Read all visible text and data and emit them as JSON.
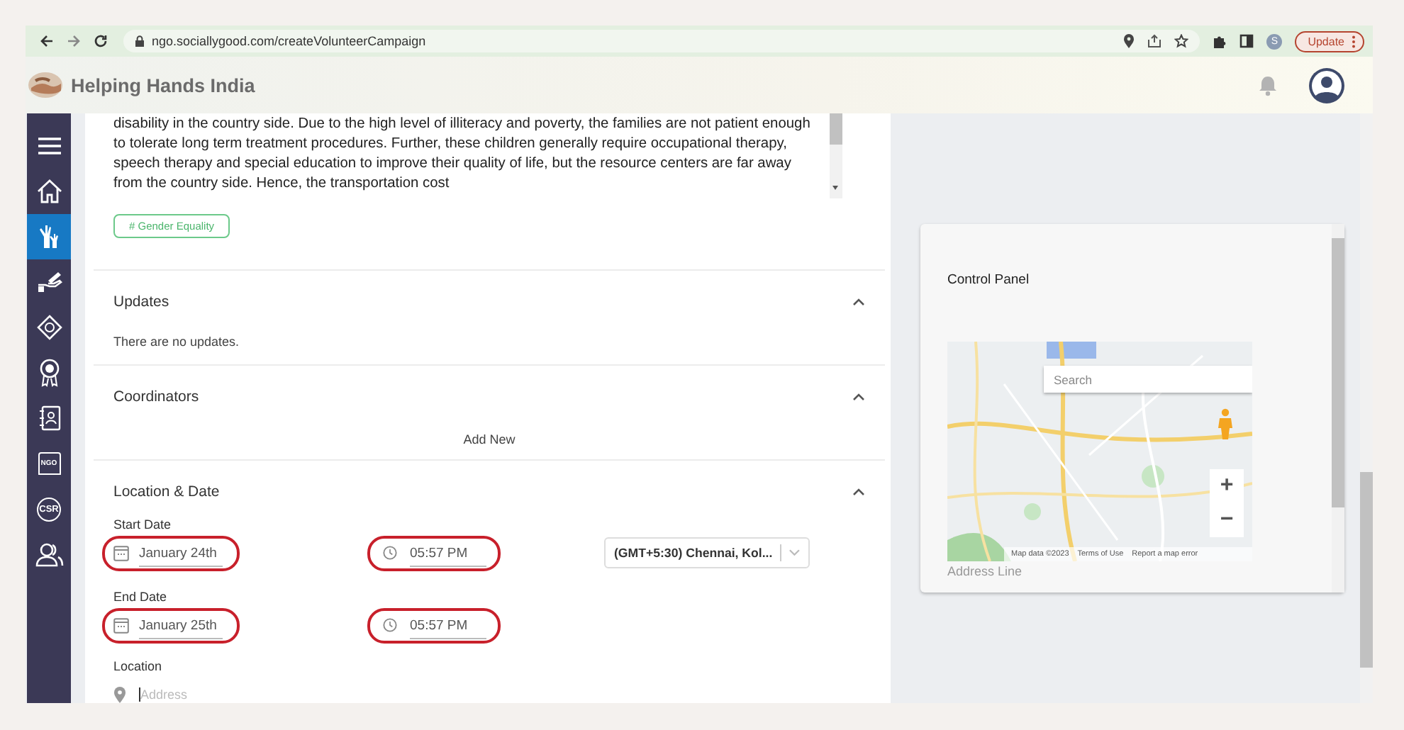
{
  "browser": {
    "url": "ngo.sociallygood.com/createVolunteerCampaign",
    "profile_initial": "S",
    "update_button": "Update"
  },
  "app": {
    "title": "Helping Hands India"
  },
  "sidebar": {
    "items": [
      {
        "kind": "menu",
        "selected": false
      },
      {
        "kind": "home",
        "selected": false
      },
      {
        "kind": "hands",
        "selected": true
      },
      {
        "kind": "donate",
        "selected": false
      },
      {
        "kind": "badge",
        "selected": false
      },
      {
        "kind": "award",
        "selected": false
      },
      {
        "kind": "contacts",
        "selected": false
      },
      {
        "kind": "building",
        "label": "NGO",
        "selected": false
      },
      {
        "kind": "circle",
        "label": "CSR",
        "selected": false
      },
      {
        "kind": "users",
        "selected": false
      }
    ]
  },
  "description": {
    "text": "disability in the country side. Due to the high level of illiteracy and poverty, the families are not patient enough to tolerate long term treatment procedures. Further, these children generally require occupational therapy, speech therapy and special education to improve their quality of life, but the resource centers are far away from the country side. Hence, the transportation cost"
  },
  "tag": "# Gender Equality",
  "sections": [
    {
      "kind": "text",
      "title": "Updates",
      "expanded": true,
      "text": "There are no updates."
    },
    {
      "kind": "action",
      "title": "Coordinators",
      "expanded": true,
      "action": "Add New"
    },
    {
      "kind": "form",
      "title": "Location & Date",
      "expanded": true
    }
  ],
  "location_date": {
    "start_label": "Start Date",
    "start_date": {
      "value": "January 24th",
      "highlighted": true
    },
    "start_time": {
      "value": "05:57 PM",
      "highlighted": true
    },
    "timezone": "(GMT+5:30) Chennai, Kol...",
    "end_label": "End Date",
    "end_date": {
      "value": "January 25th",
      "highlighted": true
    },
    "end_time": {
      "value": "05:57 PM",
      "highlighted": true
    },
    "location_label": "Location",
    "address_placeholder": "Address"
  },
  "control_panel": {
    "title": "Control Panel",
    "map": {
      "kind": "picture",
      "search_placeholder": "Search",
      "zoom_in": "+",
      "zoom_out": "−",
      "attribution": [
        "Map data ©2023",
        "Terms of Use",
        "Report a map error"
      ]
    },
    "address_placeholder": "Address Line"
  }
}
